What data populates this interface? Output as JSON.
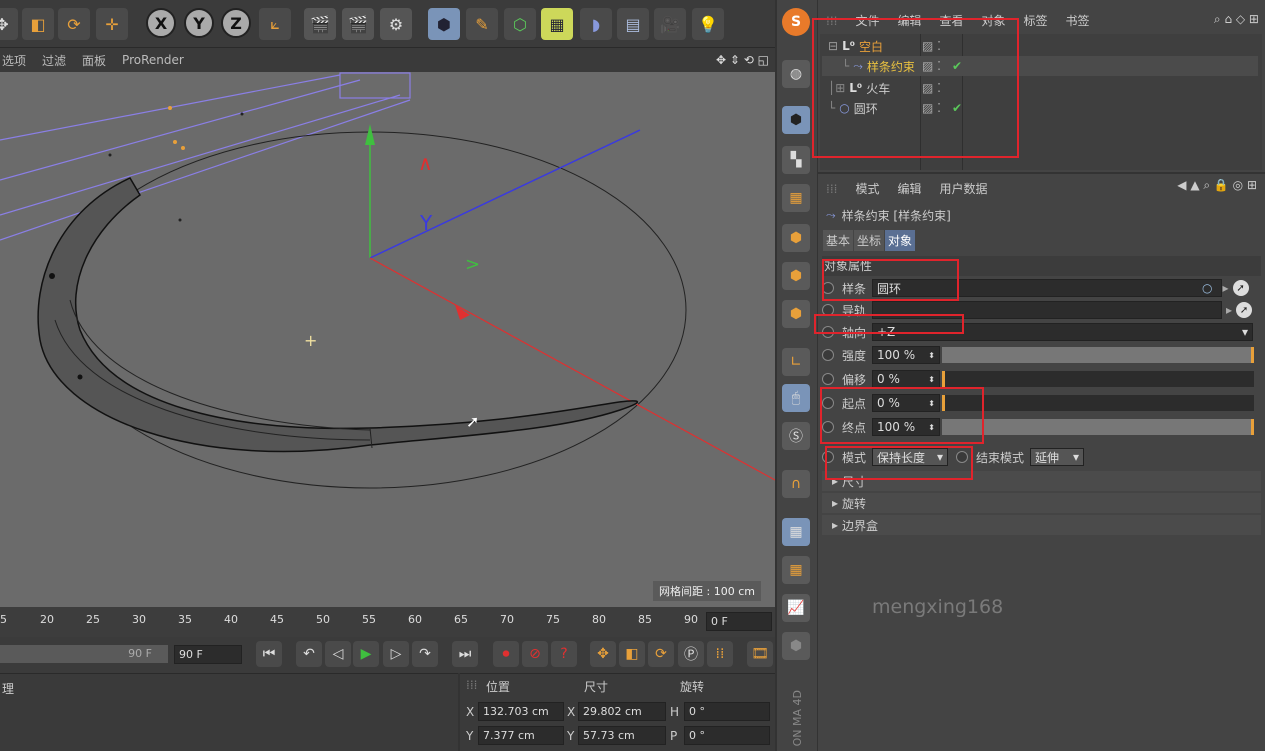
{
  "toolbar": {
    "axis_x": "X",
    "axis_y": "Y",
    "axis_z": "Z"
  },
  "viewport_menu": [
    "选项",
    "过滤",
    "面板",
    "ProRender"
  ],
  "viewport": {
    "grid_spacing": "网格间距 : 100 cm"
  },
  "timeline": {
    "ticks": [
      "5",
      "20",
      "25",
      "30",
      "35",
      "40",
      "45",
      "50",
      "55",
      "60",
      "65",
      "70",
      "75",
      "80",
      "85",
      "90"
    ],
    "current_frame": "0 F",
    "end_frame_a": "90 F",
    "end_frame_b": "90 F"
  },
  "bottom_left_label": "理",
  "coords": {
    "headers": [
      "位置",
      "尺寸",
      "旋转"
    ],
    "rows": [
      {
        "axis": "X",
        "pos": "132.703 cm",
        "size_axis": "X",
        "size": "29.802 cm",
        "rot_axis": "H",
        "rot": "0 °"
      },
      {
        "axis": "Y",
        "pos": "7.377 cm",
        "size_axis": "Y",
        "size": "57.73 cm",
        "rot_axis": "P",
        "rot": "0 °"
      }
    ]
  },
  "object_manager": {
    "menu": [
      "文件",
      "编辑",
      "查看",
      "对象",
      "标签",
      "书签"
    ],
    "objects": [
      {
        "name": "空白",
        "color": "#e8a03a"
      },
      {
        "name": "样条约束",
        "color": "#e8c040"
      },
      {
        "name": "火车",
        "color": "#cccccc"
      },
      {
        "name": "圆环",
        "color": "#cccccc"
      }
    ]
  },
  "attributes": {
    "menu": [
      "模式",
      "编辑",
      "用户数据"
    ],
    "title": "样条约束 [样条约束]",
    "tabs": [
      "基本",
      "坐标",
      "对象"
    ],
    "section_title": "对象属性",
    "spline_label": "样条",
    "spline_value": "圆环",
    "rail_label": "导轨",
    "axis_label": "轴向",
    "axis_value": "+Z",
    "strength_label": "强度",
    "strength_value": "100 %",
    "strength_fraction": 1.0,
    "offset_label": "偏移",
    "offset_value": "0 %",
    "offset_fraction": 0.0,
    "start_label": "起点",
    "start_value": "0 %",
    "start_fraction": 0.0,
    "end_label": "终点",
    "end_value": "100 %",
    "end_fraction": 1.0,
    "mode_label": "模式",
    "mode_value": "保持长度",
    "end_mode_label": "结束模式",
    "end_mode_value": "延伸",
    "sections": [
      "尺寸",
      "旋转",
      "边界盒"
    ]
  },
  "watermark": "mengxing168",
  "vertical_brand": "MA 4D",
  "vertical_brand2": "ON",
  "colors": {
    "accent_orange": "#e8a03a",
    "highlight_red": "#e0242c",
    "active_tab": "#5a6f93"
  }
}
